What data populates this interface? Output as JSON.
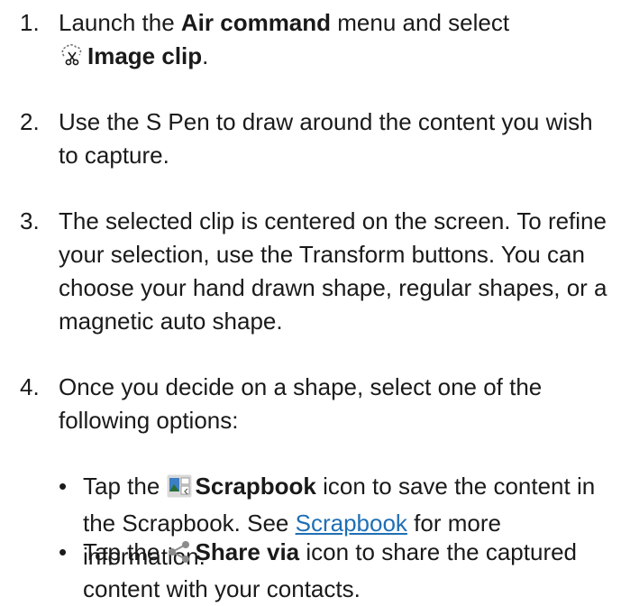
{
  "steps": [
    {
      "number": "1.",
      "pre": "Launch the ",
      "bold1": "Air command",
      "mid": " menu and select",
      "icon": "image-clip-icon",
      "bold2": "Image clip",
      "post": "."
    },
    {
      "number": "2.",
      "text": "Use the S Pen to draw around the content you wish to capture."
    },
    {
      "number": "3.",
      "text": "The selected clip is centered on the screen. To refine your selection, use the Transform buttons. You can choose your hand drawn shape, regular shapes, or a magnetic auto shape."
    },
    {
      "number": "4.",
      "text": "Once you decide on a shape, select one of the following options:"
    }
  ],
  "options": [
    {
      "bullet": "•",
      "pre": "Tap the ",
      "icon": "scrapbook-icon",
      "bold": "Scrapbook",
      "mid": " icon to save the content in the Scrapbook. See ",
      "link": "Scrapbook",
      "post": " for more information."
    },
    {
      "bullet": "•",
      "pre": "Tap the ",
      "icon": "share-icon",
      "bold": "Share via",
      "post": " icon to share the captured content with your contacts."
    }
  ],
  "colors": {
    "text": "#1a1a1a",
    "link": "#1f6fb5",
    "scrapbook_icon_bg": "#d9d9d9",
    "share_icon": "#8c8c8c"
  }
}
